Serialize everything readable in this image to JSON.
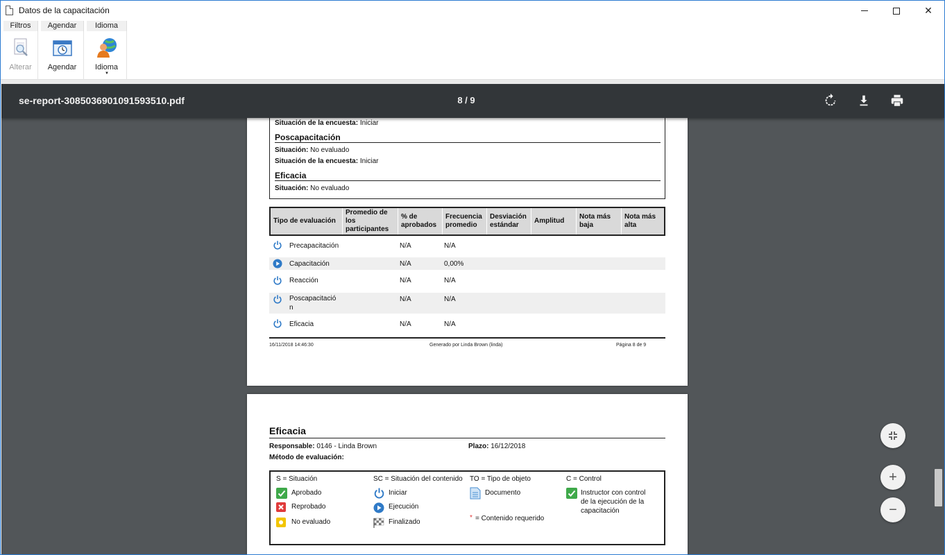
{
  "window": {
    "title": "Datos de la capacitación"
  },
  "ribbon": {
    "tabs": [
      "Filtros",
      "Agendar",
      "Idioma"
    ],
    "buttons": {
      "alterar": "Alterar",
      "agendar": "Agendar",
      "idioma": "Idioma"
    }
  },
  "viewer": {
    "filename": "se-report-3085036901091593510.pdf",
    "page_indicator": "8 / 9"
  },
  "page1": {
    "top_label": "Situación de la encuesta:",
    "top_value": "Iniciar",
    "poscap_title": "Poscapacitación",
    "poscap_sit_label": "Situación:",
    "poscap_sit_value": "No evaluado",
    "poscap_enc_label": "Situación de la encuesta:",
    "poscap_enc_value": "Iniciar",
    "eficacia_title": "Eficacia",
    "eficacia_sit_label": "Situación:",
    "eficacia_sit_value": "No evaluado",
    "table": {
      "headers": [
        "Tipo de evaluación",
        "Promedio de los participantes",
        "% de aprobados",
        "Frecuencia promedio",
        "Desviación estándar",
        "Amplitud",
        "Nota más baja",
        "Nota más alta"
      ],
      "rows": [
        {
          "icon": "power-icon",
          "name": "Precapacitación",
          "aprobados": "N/A",
          "frecuencia": "N/A"
        },
        {
          "icon": "play-icon",
          "name": "Capacitación",
          "aprobados": "N/A",
          "frecuencia": "0,00%"
        },
        {
          "icon": "power-icon",
          "name": "Reacción",
          "aprobados": "N/A",
          "frecuencia": "N/A"
        },
        {
          "icon": "power-icon",
          "name": "Poscapacitació",
          "name2": "n",
          "aprobados": "N/A",
          "frecuencia": "N/A"
        },
        {
          "icon": "power-icon",
          "name": "Eficacia",
          "aprobados": "N/A",
          "frecuencia": "N/A"
        }
      ]
    },
    "footer": {
      "date": "16/11/2018 14:46:30",
      "generated": "Generado por Linda Brown (linda)",
      "page": "Página 8 de 9"
    }
  },
  "page2": {
    "title": "Eficacia",
    "responsable_label": "Responsable:",
    "responsable_value": "0146 - Linda Brown",
    "plazo_label": "Plazo:",
    "plazo_value": "16/12/2018",
    "metodo_label": "Método de evaluación:",
    "legend": {
      "s_title": "S = Situación",
      "s_items": [
        "Aprobado",
        "Reprobado",
        "No evaluado"
      ],
      "sc_title": "SC = Situación del contenido",
      "sc_items": [
        "Iniciar",
        "Ejecución",
        "Finalizado"
      ],
      "to_title": "TO = Tipo de objeto",
      "to_items": [
        "Documento"
      ],
      "required_mark": "*",
      "required_text": "= Contenido requerido",
      "c_title": "C = Control",
      "c_item_lines": [
        "Instructor con control",
        "de la ejecución de la",
        "capacitación"
      ]
    }
  },
  "colors": {
    "accent_blue": "#2b7bd1",
    "toolbar_bg": "#323639",
    "viewer_bg": "#525659",
    "green": "#3fa94a",
    "red": "#e03b3b",
    "yellow": "#f2c500"
  }
}
